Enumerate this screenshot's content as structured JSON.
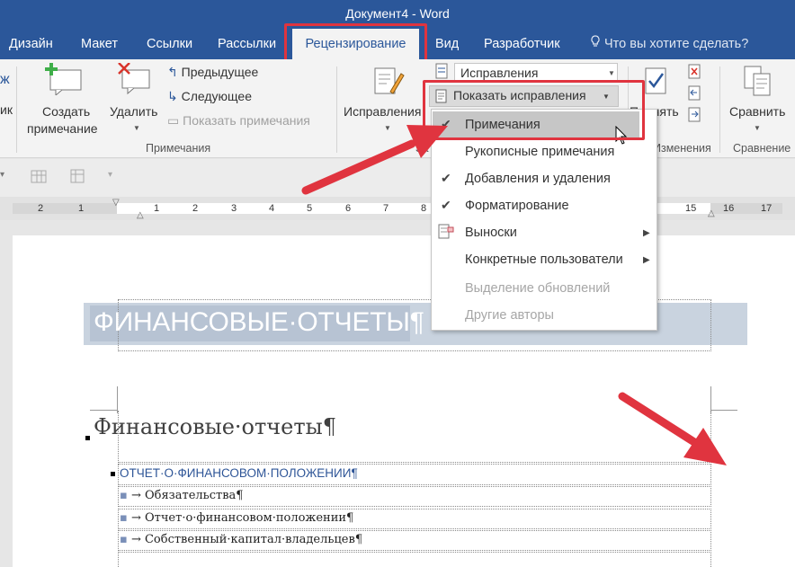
{
  "window": {
    "title": "Документ4 - Word"
  },
  "tabs": [
    {
      "label": "Дизайн"
    },
    {
      "label": "Макет"
    },
    {
      "label": "Ссылки"
    },
    {
      "label": "Рассылки"
    },
    {
      "label": "Рецензирование",
      "active": true
    },
    {
      "label": "Вид"
    },
    {
      "label": "Разработчик"
    }
  ],
  "tell_me": "Что вы хотите сделать?",
  "ribbon": {
    "create_comment": [
      "Создать",
      "примечание"
    ],
    "delete": "Удалить",
    "previous": "Предыдущее",
    "next": "Следующее",
    "show_comments": "Показать примечания",
    "comments_group": "Примечания",
    "tracking": "Исправления",
    "tracking_combo": "Исправления",
    "show_markup": "Показать исправления",
    "tracking_group_fragment": "За",
    "accept_fragment": "Принять",
    "changes_group_fragment": "Изменения",
    "compare": "Сравнить",
    "compare_group": "Сравнение",
    "left_fragment_1": "ик",
    "left_fragment_2": "ж"
  },
  "ruler_ticks": [
    "2",
    "1",
    "1",
    "2",
    "3",
    "4",
    "5",
    "6",
    "7",
    "8",
    "15",
    "16",
    "17"
  ],
  "document": {
    "heading1": "ФИНАНСОВЫЕ·ОТЧЕТЫ¶",
    "heading2": "Финансовые·отчеты¶",
    "toc_line": "ОТЧЕТ·О·ФИНАНСОВОМ·ПОЛОЖЕНИИ¶",
    "list": [
      "Обязательства¶",
      "Отчет·о·финансовом·положении¶",
      "Собственный·капитал·владельцев¶"
    ]
  },
  "dropdown": {
    "items": [
      {
        "label": "Примечания",
        "checked": true,
        "highlighted": true
      },
      {
        "label": "Рукописные примечания",
        "checked": false
      },
      {
        "label": "Добавления и удаления",
        "checked": true
      },
      {
        "label": "Форматирование",
        "checked": true
      },
      {
        "label": "Выноски",
        "submenu": true
      },
      {
        "label": "Конкретные пользователи",
        "submenu": true
      },
      {
        "label": "Выделение обновлений",
        "disabled": true
      },
      {
        "label": "Другие авторы",
        "disabled": true
      }
    ]
  },
  "colors": {
    "accent": "#2b579a",
    "annotation_red": "#e0343f"
  }
}
